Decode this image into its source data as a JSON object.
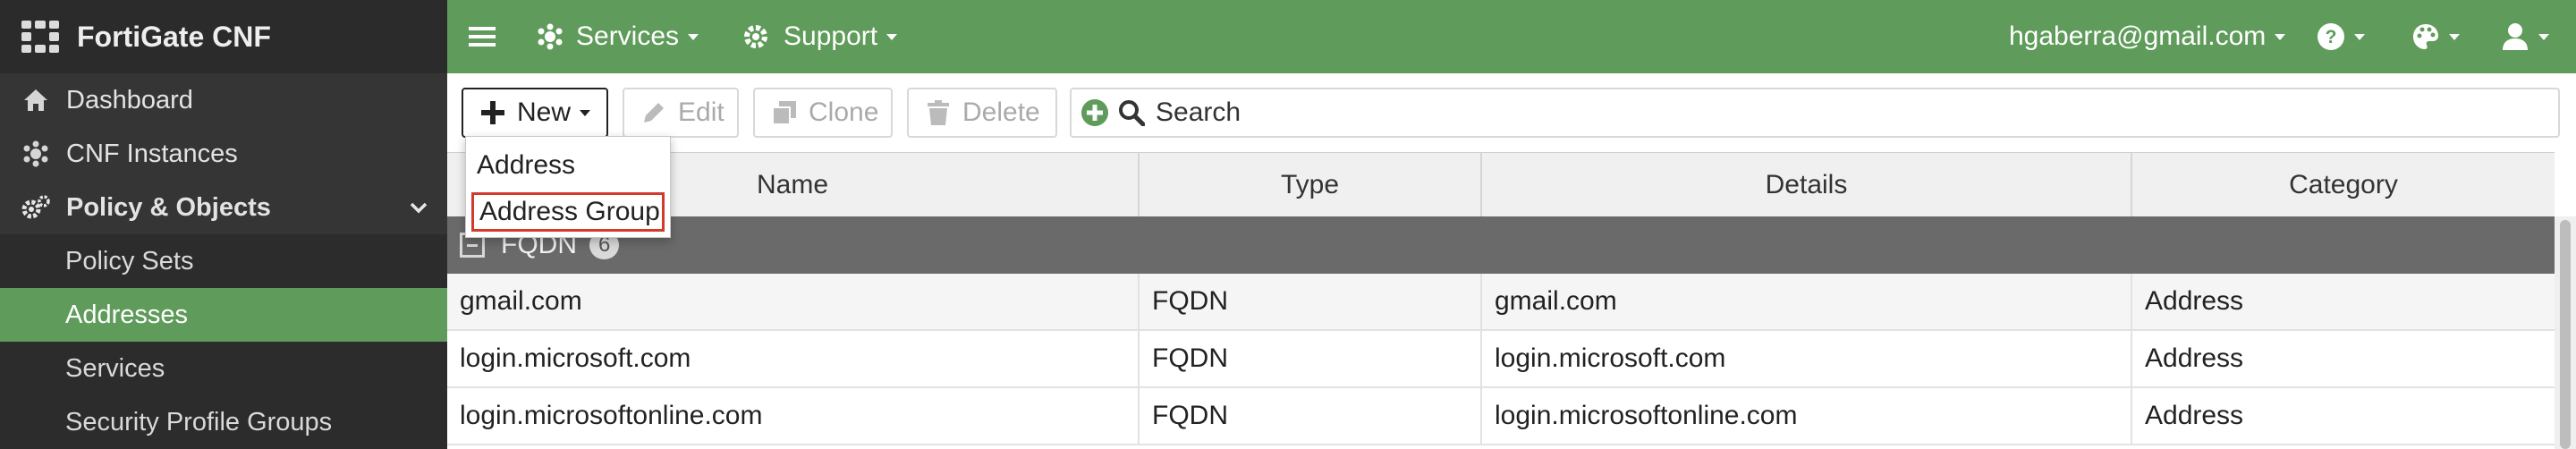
{
  "sidebar": {
    "brand": "FortiGate CNF",
    "items": [
      {
        "label": "Dashboard",
        "icon": "home-icon"
      },
      {
        "label": "CNF Instances",
        "icon": "cluster-icon"
      },
      {
        "label": "Policy & Objects",
        "icon": "gears-icon",
        "expanded": true
      }
    ],
    "sub_items": [
      {
        "label": "Policy Sets",
        "active": false
      },
      {
        "label": "Addresses",
        "active": true
      },
      {
        "label": "Services",
        "active": false
      },
      {
        "label": "Security Profile Groups",
        "active": false
      }
    ]
  },
  "topbar": {
    "services": "Services",
    "support": "Support",
    "user_email": "hgaberra@gmail.com"
  },
  "toolbar": {
    "new_label": "New",
    "edit_label": "Edit",
    "clone_label": "Clone",
    "delete_label": "Delete",
    "search_placeholder": "Search"
  },
  "new_menu": {
    "items": [
      "Address",
      "Address Group"
    ]
  },
  "table": {
    "columns": [
      "Name",
      "Type",
      "Details",
      "Category"
    ],
    "group": {
      "label": "FQDN",
      "count": "6"
    },
    "rows": [
      {
        "name": "gmail.com",
        "type": "FQDN",
        "details": "gmail.com",
        "category": "Address"
      },
      {
        "name": "login.microsoft.com",
        "type": "FQDN",
        "details": "login.microsoft.com",
        "category": "Address"
      },
      {
        "name": "login.microsoftonline.com",
        "type": "FQDN",
        "details": "login.microsoftonline.com",
        "category": "Address"
      }
    ]
  },
  "colors": {
    "accent": "#5f9b5a",
    "sidebar_bg": "#353535",
    "highlight_border": "#d23b2b"
  }
}
